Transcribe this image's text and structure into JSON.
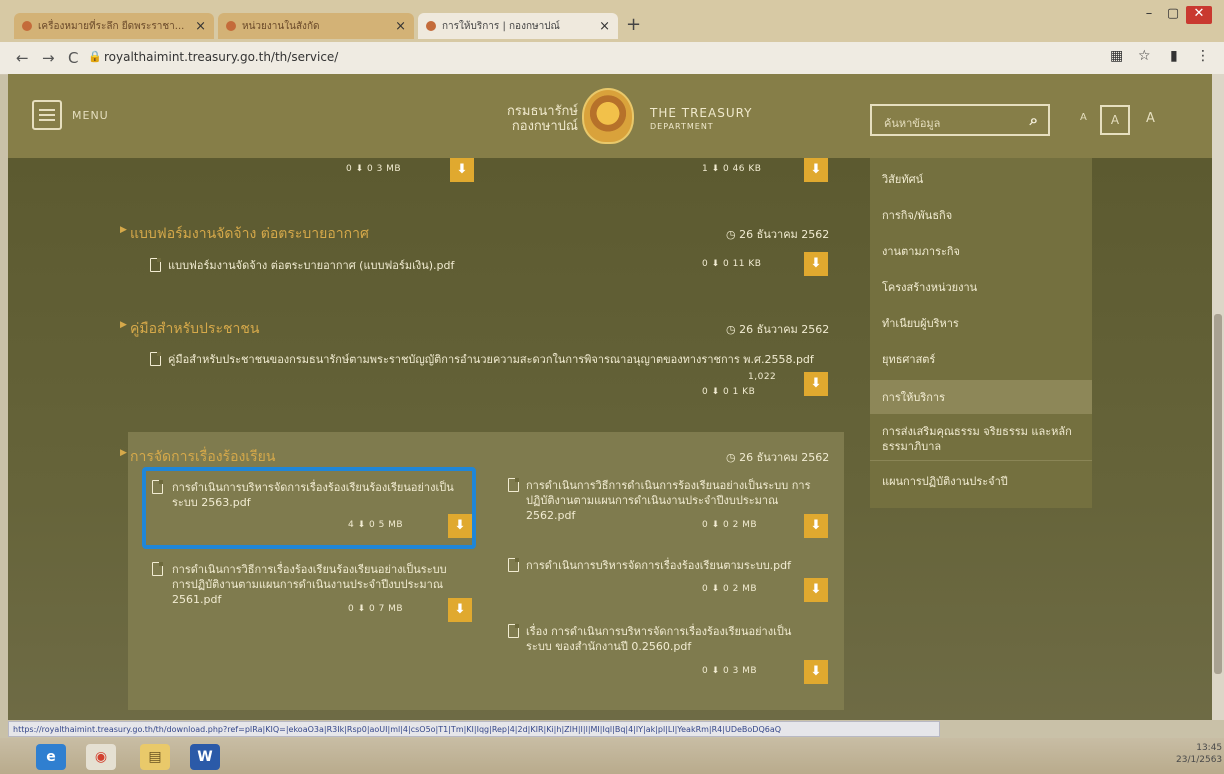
{
  "browser": {
    "tabs": [
      {
        "label": "เครื่องหมายที่ระลึก ยืดพระราชา...",
        "close": "×"
      },
      {
        "label": "หน่วยงานในสังกัด",
        "close": "×"
      },
      {
        "label": "การให้บริการ | กองกษาปณ์",
        "close": "×"
      }
    ],
    "new_tab": "+",
    "url": "royalthaimint.treasury.go.th/th/service/",
    "nav": {
      "back": "←",
      "forward": "→",
      "reload": "C"
    },
    "window": {
      "minimize": "–",
      "maximize": "▢",
      "close": "✕"
    },
    "status_url": "https://royalthaimint.treasury.go.th/th/download.php?ref=pIRa|KIQ=|ekoaO3a|R3Ik|Rsp0|aoUI|ml|4|csO5o|T1|Tm|KI|Iqg|Rep|4|2d|KIR|Ki|h|ZlH|I|l|MI|Iql|Bq|4|lY|ak|pl|Ll|YeakRm|R4|UDeBoDQ6aQ"
  },
  "site": {
    "menu_label": "MENU",
    "logo_th_1": "กรมธนารักษ์",
    "logo_th_2": "กองกษาปณ์",
    "logo_en_1": "THE TREASURY",
    "logo_en_2": "DEPARTMENT",
    "search_placeholder": "ค้นหาข้อมูล",
    "font_sizes": [
      "A",
      "A",
      "A"
    ]
  },
  "top_items": [
    {
      "meta": "0  ⬇ 0  3 MB"
    },
    {
      "meta": "1  ⬇ 0  46 KB"
    }
  ],
  "sections": [
    {
      "title": "แบบฟอร์มงานจัดจ้าง ต่อตระบายอากาศ",
      "date": "26 ธันวาคม 2562",
      "files": [
        {
          "name": "แบบฟอร์มงานจัดจ้าง ต่อตระบายอากาศ (แบบฟอร์มเงิน).pdf",
          "meta": "0  ⬇ 0  11 KB"
        }
      ]
    },
    {
      "title": "คู่มือสำหรับประชาชน",
      "date": "26 ธันวาคม 2562",
      "files": [
        {
          "name": "คู่มือสำหรับประชาชนของกรมธนารักษ์ตามพระราชบัญญัติการอำนวยความสะดวกในการพิจารณาอนุญาตของทางราชการ พ.ศ.2558.pdf",
          "meta_top": "1,022",
          "meta": "0  ⬇ 0  1 KB"
        }
      ]
    },
    {
      "title": "การจัดการเรื่องร้องเรียน",
      "date": "26 ธันวาคม 2562",
      "files": [
        {
          "name": "การดำเนินการบริหารจัดการเรื่องร้องเรียนร้องเรียนอย่างเป็นระบบ 2563.pdf",
          "meta": "4  ⬇ 0  5 MB"
        },
        {
          "name": "การดำเนินการวิธีการดำเนินการร้องเรียนอย่างเป็นระบบ การปฏิบัติงานตามแผนการดำเนินงานประจำปีงบประมาณ 2562.pdf",
          "meta": "0  ⬇ 0  2 MB"
        },
        {
          "name": "การดำเนินการวิธีการเรื่องร้องเรียนร้องเรียนอย่างเป็นระบบ การปฏิบัติงานตามแผนการดำเนินงานประจำปีงบประมาณ 2561.pdf",
          "meta": "0  ⬇ 0  7 MB"
        },
        {
          "name": "การดำเนินการบริหารจัดการเรื่องร้องเรียนตามระบบ.pdf",
          "meta": "0  ⬇ 0  2 MB"
        },
        {
          "name": "เรื่อง การดำเนินการบริหารจัดการเรื่องร้องเรียนอย่างเป็นระบบ ของสำนักงานปี 0.2560.pdf",
          "meta": "0  ⬇ 0  3 MB"
        }
      ]
    }
  ],
  "submenu": [
    "วิสัยทัศน์",
    "การกิจ/พันธกิจ",
    "งานตามภาระกิจ",
    "โครงสร้างหน่วยงาน",
    "ทำเนียบผู้บริหาร",
    "ยุทธศาสตร์",
    "การให้บริการ",
    "การส่งเสริมคุณธรรม จริยธรรม และหลักธรรมาภิบาล",
    "แผนการปฏิบัติงานประจำปี"
  ],
  "taskbar": {
    "apps": [
      "e",
      "◉",
      "▤",
      "W"
    ],
    "clock_time": "13:45",
    "clock_date": "23/1/2563"
  },
  "colors": {
    "highlight": "#1f86d8",
    "download": "#e0a92f",
    "title": "#d6a94a"
  }
}
